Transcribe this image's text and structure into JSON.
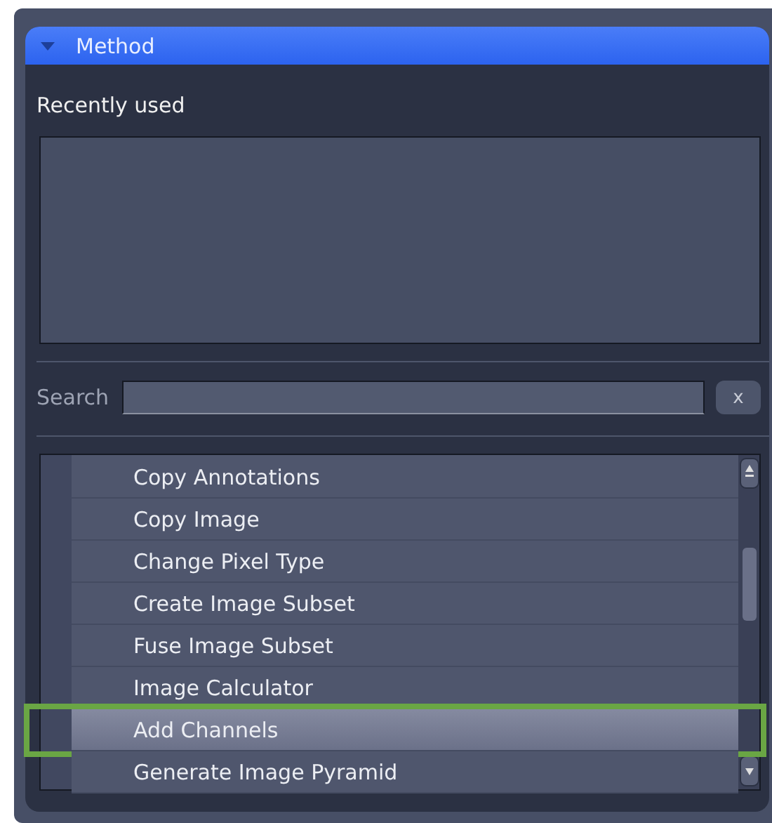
{
  "panel": {
    "title": "Method",
    "expanded": true
  },
  "recently_used": {
    "label": "Recently used"
  },
  "search": {
    "label": "Search",
    "clear": "x"
  },
  "methods": [
    {
      "label": "Copy Annotations",
      "selected": false,
      "annotated": false
    },
    {
      "label": "Copy Image",
      "selected": false,
      "annotated": false
    },
    {
      "label": "Change Pixel Type",
      "selected": false,
      "annotated": false
    },
    {
      "label": "Create Image Subset",
      "selected": false,
      "annotated": false
    },
    {
      "label": "Fuse Image Subset",
      "selected": false,
      "annotated": false
    },
    {
      "label": "Image Calculator",
      "selected": false,
      "annotated": false
    },
    {
      "label": "Add Channels",
      "selected": true,
      "annotated": true
    },
    {
      "label": "Generate Image Pyramid",
      "selected": false,
      "annotated": false
    }
  ]
}
